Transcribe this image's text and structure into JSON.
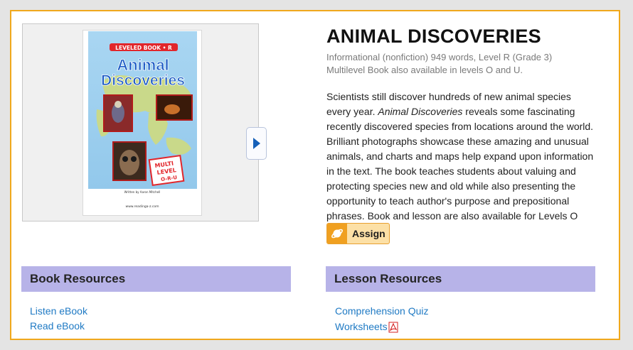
{
  "book": {
    "title": "ANIMAL DISCOVERIES",
    "meta_line1": "Informational (nonfiction) 949 words, Level R (Grade 3)",
    "meta_line2": "Multilevel Book also available in levels O and U.",
    "description_part1": "Scientists still discover hundreds of new animal species every year. ",
    "description_italic": "Animal Discoveries",
    "description_part2": " reveals some fascinating recently discovered species from locations around the world. Brilliant photographs showcase these amazing and unusual animals, and charts and maps help expand upon information in the text. The book teaches students about valuing and protecting species new and old while also presenting the opportunity to teach author's purpose and prepositional phrases. Book and lesson are also available for Levels O and U."
  },
  "cover": {
    "banner": "LEVELED BOOK • R",
    "title_line1": "Animal",
    "title_line2": "Discoveries",
    "badge_line1": "MULTI",
    "badge_line2": "LEVEL",
    "badge_line3": "O-R-U",
    "byline": "Written by Aaron Mitchell",
    "site": "www.readinga-z.com"
  },
  "assign_button": {
    "label": "Assign",
    "icon": "planet-icon"
  },
  "book_resources": {
    "heading": "Book Resources",
    "links": [
      "Listen eBook",
      "Read eBook"
    ]
  },
  "lesson_resources": {
    "heading": "Lesson Resources",
    "links": [
      "Comprehension Quiz",
      "Worksheets"
    ],
    "worksheets_icon": "pdf-icon"
  },
  "colors": {
    "panel_border": "#f0a81c",
    "header_bg": "#b7b3e8",
    "link": "#1f7ac4",
    "assign_bg": "#fce0a6",
    "assign_icon_bg": "#f0a020"
  }
}
